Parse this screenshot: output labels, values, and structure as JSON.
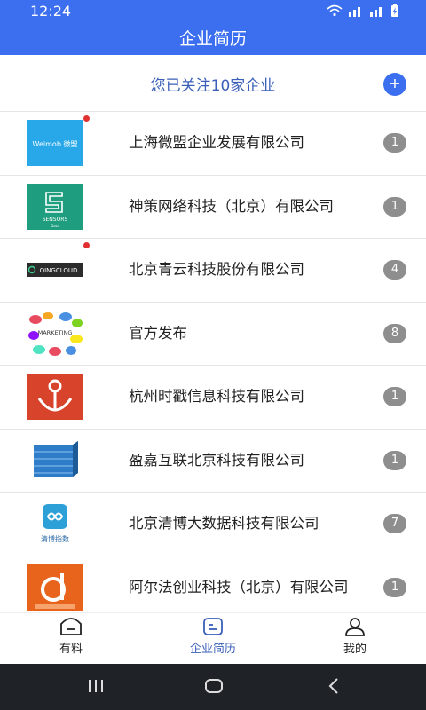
{
  "status": {
    "time": "12:24"
  },
  "title": "企业简历",
  "follow": {
    "text": "您已关注10家企业",
    "add_label": "+"
  },
  "companies": [
    {
      "name": "上海微盟企业发展有限公司",
      "count": "1",
      "logo_text": "Weimob 微盟",
      "dot": true
    },
    {
      "name": "神策网络科技（北京）有限公司",
      "count": "1",
      "logo_text": "SENSORS",
      "logo_sub": "Data",
      "dot": false
    },
    {
      "name": "北京青云科技股份有限公司",
      "count": "4",
      "logo_text": "QINGCLOUD",
      "dot": true
    },
    {
      "name": "官方发布",
      "count": "8",
      "logo_text": "MARKETING",
      "dot": false
    },
    {
      "name": "杭州时戳信息科技有限公司",
      "count": "1",
      "logo_text": "",
      "dot": false
    },
    {
      "name": "盈嘉互联北京科技有限公司",
      "count": "1",
      "logo_text": "",
      "dot": false
    },
    {
      "name": "北京清博大数据科技有限公司",
      "count": "7",
      "logo_text": "清博指数",
      "dot": false
    },
    {
      "name": "阿尔法创业科技（北京）有限公司",
      "count": "1",
      "logo_text": "",
      "dot": false
    }
  ],
  "tabs": [
    {
      "label": "有料"
    },
    {
      "label": "企业简历"
    },
    {
      "label": "我的"
    }
  ],
  "colors": {
    "primary": "#3b6ff0",
    "accent_text": "#3a5fb8",
    "badge": "#8e8e8e",
    "dot": "#e03030"
  }
}
